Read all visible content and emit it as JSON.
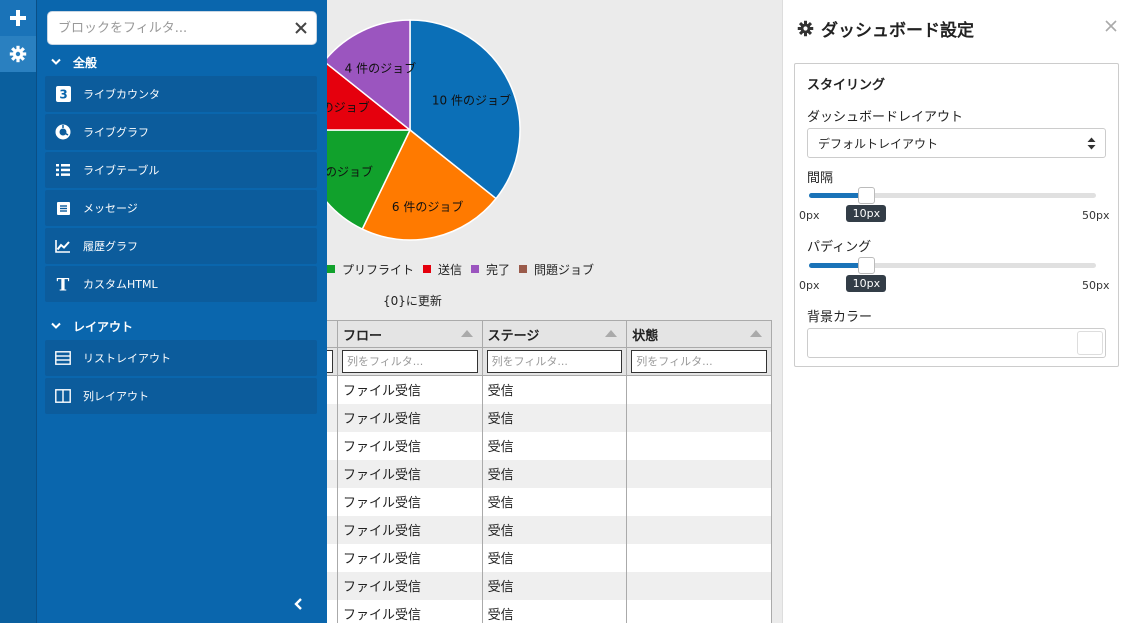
{
  "rail": {
    "add_icon": "plus-icon",
    "settings_icon": "gear-icon"
  },
  "blocks": {
    "filter_placeholder": "ブロックをフィルタ...",
    "groups": [
      {
        "label": "全般",
        "items": [
          {
            "label": "ライブカウンタ",
            "icon": "counter-icon"
          },
          {
            "label": "ライブグラフ",
            "icon": "donut-chart-icon"
          },
          {
            "label": "ライブテーブル",
            "icon": "list-icon"
          },
          {
            "label": "メッセージ",
            "icon": "message-icon"
          },
          {
            "label": "履歴グラフ",
            "icon": "line-chart-icon"
          },
          {
            "label": "カスタムHTML",
            "icon": "text-icon"
          }
        ]
      },
      {
        "label": "レイアウト",
        "items": [
          {
            "label": "リストレイアウト",
            "icon": "rows-layout-icon"
          },
          {
            "label": "列レイアウト",
            "icon": "columns-layout-icon"
          }
        ]
      }
    ],
    "counter_glyph": "3",
    "text_glyph": "T"
  },
  "chart_data": {
    "type": "pie",
    "slices": [
      {
        "label": "10 件のジョブ",
        "value": 10,
        "color": "#0b6fb7"
      },
      {
        "label": "6 件のジョブ",
        "value": 6,
        "color": "#ff7a00"
      },
      {
        "label": "件のジョブ",
        "value": 5,
        "color": "#11a12c"
      },
      {
        "label": "のジョブ",
        "value": 3,
        "color": "#e5000d"
      },
      {
        "label": "4 件のジョブ",
        "value": 4,
        "color": "#9b55bf"
      }
    ],
    "legend": [
      {
        "label": "プリフライト",
        "color": "#11a12c"
      },
      {
        "label": "送信",
        "color": "#e5000d"
      },
      {
        "label": "完了",
        "color": "#9b55bf"
      },
      {
        "label": "問題ジョブ",
        "color": "#9a5a4a"
      }
    ],
    "legend_placement": "bottom"
  },
  "dashboard": {
    "updated_text": "{0}に更新",
    "columns": [
      "フロー",
      "ステージ",
      "状態"
    ],
    "column_filter_placeholder": "列をフィルタ...",
    "rows": [
      [
        "ファイル受信",
        "受信",
        ""
      ],
      [
        "ファイル受信",
        "受信",
        ""
      ],
      [
        "ファイル受信",
        "受信",
        ""
      ],
      [
        "ファイル受信",
        "受信",
        ""
      ],
      [
        "ファイル受信",
        "受信",
        ""
      ],
      [
        "ファイル受信",
        "受信",
        ""
      ],
      [
        "ファイル受信",
        "受信",
        ""
      ],
      [
        "ファイル受信",
        "受信",
        ""
      ],
      [
        "ファイル受信",
        "受信",
        ""
      ]
    ]
  },
  "settings": {
    "title": "ダッシュボード設定",
    "section_title": "スタイリング",
    "layout_label": "ダッシュボードレイアウト",
    "layout_value": "デフォルトレイアウト",
    "spacing": {
      "label": "間隔",
      "value": 10,
      "min": 0,
      "max": 50,
      "value_text": "10px",
      "min_text": "0px",
      "max_text": "50px"
    },
    "padding": {
      "label": "パディング",
      "value": 10,
      "min": 0,
      "max": 50,
      "value_text": "10px",
      "min_text": "0px",
      "max_text": "50px"
    },
    "bg_color_label": "背景カラー",
    "accent_color": "#0a66ad"
  }
}
